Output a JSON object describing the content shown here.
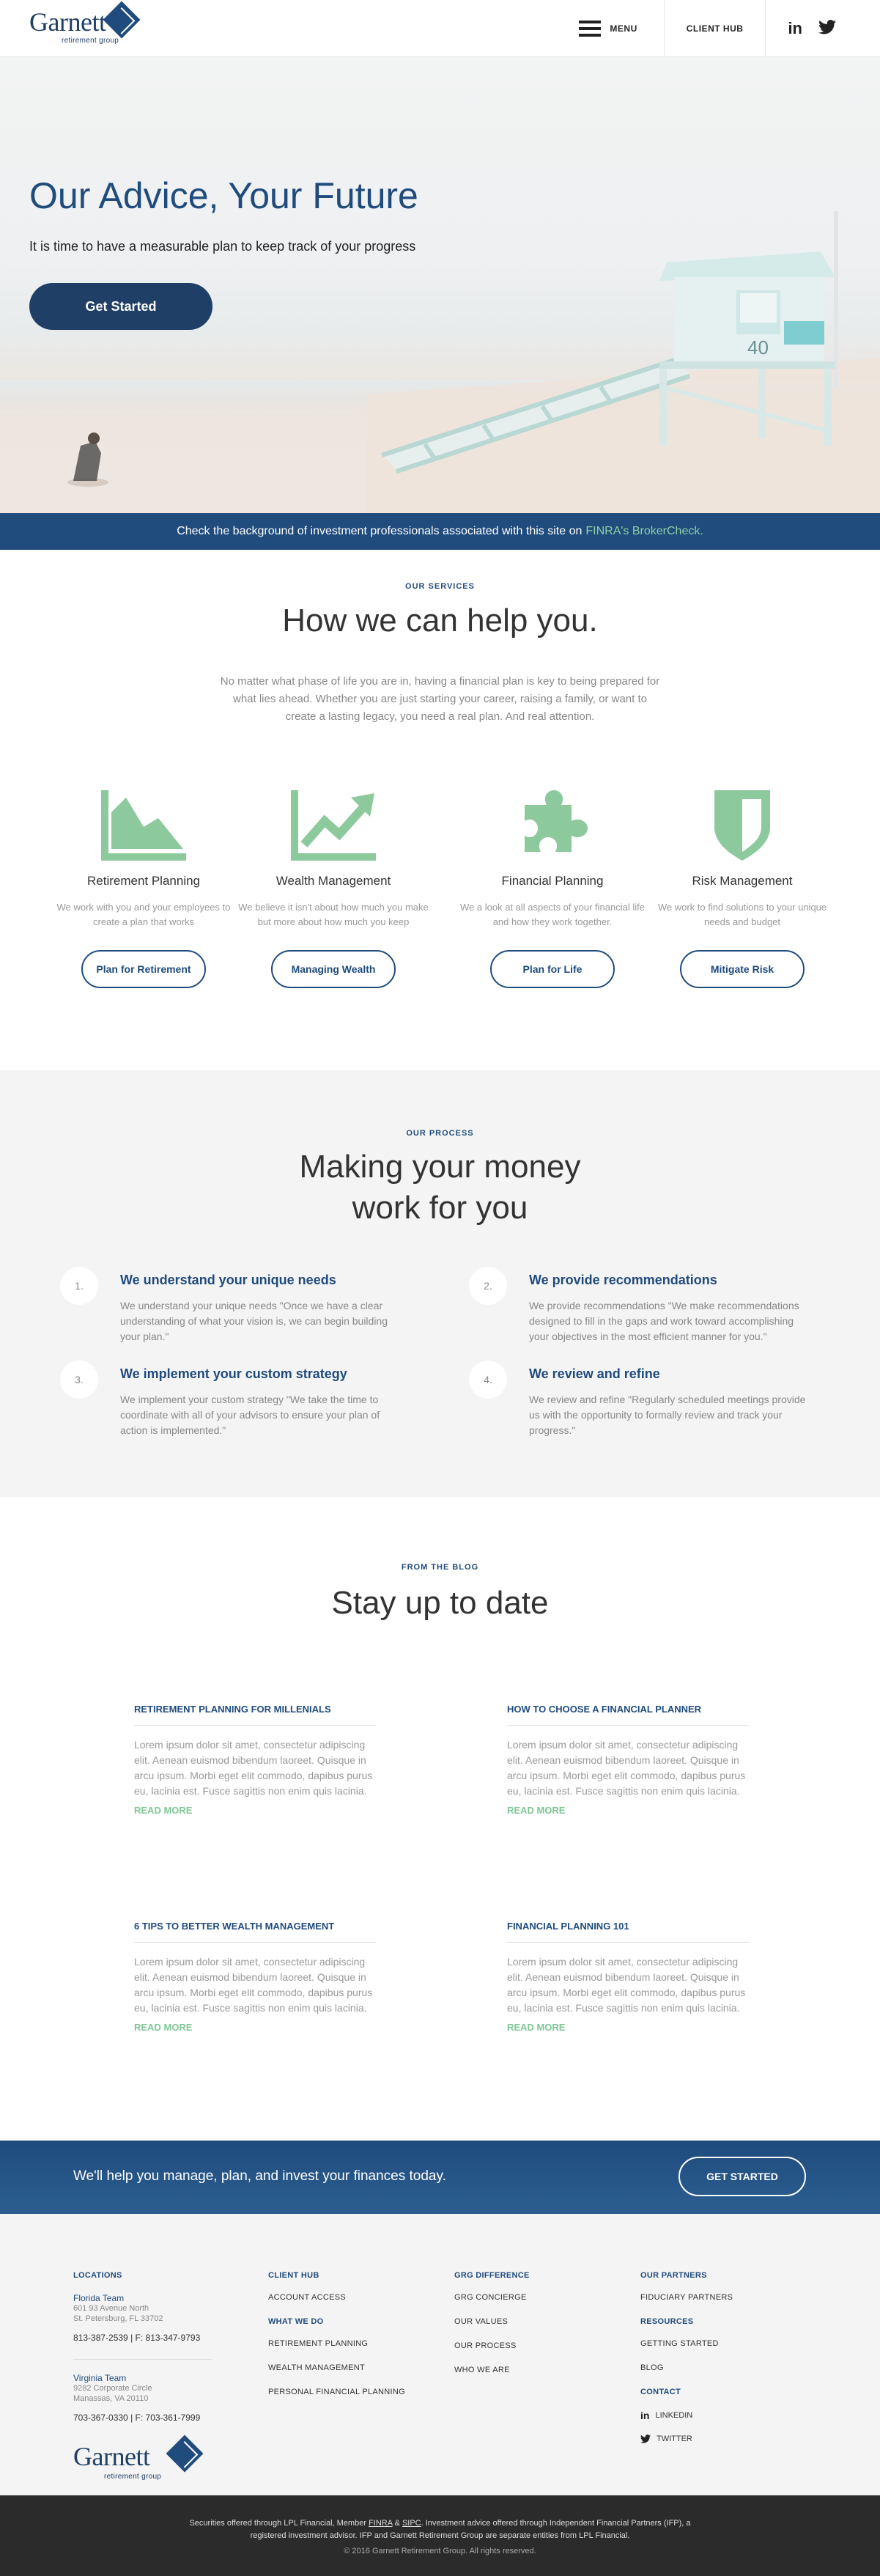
{
  "header": {
    "logo_word": "Garnett",
    "logo_sub": "retirement group",
    "menu_label": "MENU",
    "client_hub": "CLIENT HUB",
    "linkedin": "in"
  },
  "hero": {
    "title": "Our Advice, Your Future",
    "subtitle": "It is time to have a measurable plan to keep track of your progress",
    "cta": "Get Started",
    "tower_sign": "40"
  },
  "finra": {
    "text": "Check the background of investment professionals associated with this site on",
    "link": "FINRA's BrokerCheck."
  },
  "services": {
    "eyebrow": "OUR SERVICES",
    "title": "How we can help you.",
    "lead": "No matter what phase of life you are in, having a financial plan is key to being prepared for what lies ahead. Whether you are just starting your career, raising a family, or want to create a lasting legacy, you need a real plan. And real attention.",
    "items": [
      {
        "icon": "area-chart-icon",
        "title": "Retirement Planning",
        "text": "We work with you and your employees to create a plan that works",
        "button": "Plan for Retirement"
      },
      {
        "icon": "trend-up-icon",
        "title": "Wealth Management",
        "text": "We believe it isn't about how much you make but more about how much you keep",
        "button": "Managing Wealth"
      },
      {
        "icon": "puzzle-icon",
        "title": "Financial Planning",
        "text": "We a look at all aspects of your financial life and how they work together.",
        "button": "Plan for Life"
      },
      {
        "icon": "shield-icon",
        "title": "Risk Management",
        "text": "We work to find solutions to your unique needs and budget",
        "button": "Mitigate Risk"
      }
    ]
  },
  "process": {
    "eyebrow": "OUR PROCESS",
    "title_line1": "Making your money",
    "title_line2": "work for you",
    "steps": [
      {
        "num": "1.",
        "title": "We understand your unique needs",
        "text": "We understand your unique needs \"Once we have a clear understanding of what your vision is, we can begin building your plan.\""
      },
      {
        "num": "2.",
        "title": "We provide recommendations",
        "text": "We provide recommendations \"We make recommendations designed to fill in the gaps and work toward accomplishing your objectives in the most efficient manner for you.\""
      },
      {
        "num": "3.",
        "title": "We implement your custom strategy",
        "text": "We implement your custom strategy \"We take the time to coordinate with all of your advisors to ensure your plan of action is implemented.\""
      },
      {
        "num": "4.",
        "title": "We review and refine",
        "text": "We review and refine \"Regularly scheduled meetings provide us with the opportunity to formally review and track your progress.\""
      }
    ]
  },
  "blog": {
    "eyebrow": "FROM THE BLOG",
    "title": "Stay up to date",
    "read_more": "READ MORE",
    "posts": [
      {
        "title": "RETIREMENT PLANNING FOR MILLENIALS",
        "text": "Lorem ipsum dolor sit amet, consectetur adipiscing elit. Aenean euismod bibendum laoreet. Quisque in arcu ipsum. Morbi eget elit commodo, dapibus purus eu, lacinia est. Fusce sagittis non enim quis lacinia."
      },
      {
        "title": "HOW TO CHOOSE A FINANCIAL PLANNER",
        "text": "Lorem ipsum dolor sit amet, consectetur adipiscing elit. Aenean euismod bibendum laoreet. Quisque in arcu ipsum. Morbi eget elit commodo, dapibus purus eu, lacinia est. Fusce sagittis non enim quis lacinia."
      },
      {
        "title": "6 TIPS TO BETTER WEALTH MANAGEMENT",
        "text": "Lorem ipsum dolor sit amet, consectetur adipiscing elit. Aenean euismod bibendum laoreet. Quisque in arcu ipsum. Morbi eget elit commodo, dapibus purus eu, lacinia est. Fusce sagittis non enim quis lacinia."
      },
      {
        "title": "FINANCIAL PLANNING 101",
        "text": "Lorem ipsum dolor sit amet, consectetur adipiscing elit. Aenean euismod bibendum laoreet. Quisque in arcu ipsum. Morbi eget elit commodo, dapibus purus eu, lacinia est. Fusce sagittis non enim quis lacinia."
      }
    ]
  },
  "cta": {
    "text": "We'll help you manage, plan, and invest your finances today.",
    "button": "GET STARTED"
  },
  "footer": {
    "locations": {
      "heading": "LOCATIONS",
      "fl_team": "Florida Team",
      "fl_addr1": "601 93 Avenue North",
      "fl_addr2": "St. Petersburg, FL 33702",
      "fl_phone": "813-387-2539 | F: 813-347-9793",
      "va_team": "Virginia Team",
      "va_addr1": "9282 Corporate Circle",
      "va_addr2": "Manassas, VA 20110",
      "va_phone": "703-367-0330 | F: 703-361-7999"
    },
    "client_hub": {
      "heading": "CLIENT HUB",
      "link": "ACCOUNT ACCESS"
    },
    "what_we_do": {
      "heading": "WHAT WE DO",
      "links": [
        "RETIREMENT PLANNING",
        "WEALTH MANAGEMENT",
        "PERSONAL FINANCIAL PLANNING"
      ]
    },
    "grg": {
      "heading": "GRG DIFFERENCE",
      "links": [
        "GRG CONCIERGE",
        "OUR VALUES",
        "OUR PROCESS",
        "WHO WE ARE"
      ]
    },
    "partners": {
      "heading": "OUR PARTNERS",
      "link": "FIDUCIARY PARTNERS"
    },
    "resources": {
      "heading": "RESOURCES",
      "links": [
        "GETTING STARTED",
        "BLOG"
      ]
    },
    "contact": {
      "heading": "CONTACT",
      "linkedin": "LINKEDIN",
      "twitter": "TWITTER"
    }
  },
  "legal": {
    "p1": "Securities offered through LPL Financial, Member",
    "finra": "FINRA",
    "amp": "&",
    "sipc": "SIPC",
    "p2": ". Investment advice offered through Independent Financial Partners (IFP), a",
    "line2": "registered investment advisor.  IFP and Garnett Retirement Group are separate entities from LPL Financial.",
    "copyright": "© 2016 Garnett Retirement Group. All rights reserved."
  },
  "colors": {
    "brand_navy": "#1f4b7d",
    "accent_green": "#7fc796",
    "icon_green": "#8cc99c"
  }
}
